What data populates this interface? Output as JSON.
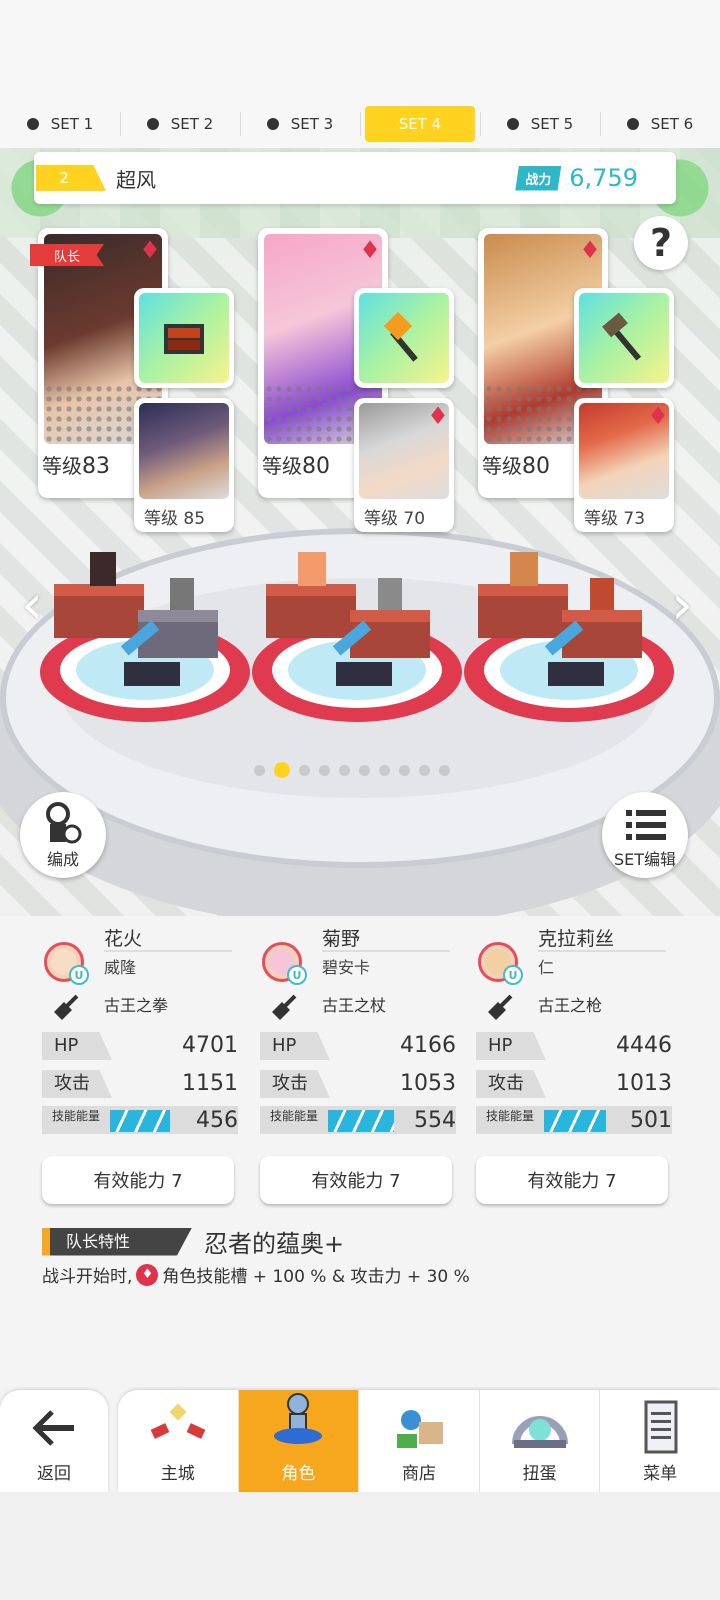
{
  "set_tabs": [
    {
      "label": "SET 1",
      "active": false
    },
    {
      "label": "SET 2",
      "active": false
    },
    {
      "label": "SET 3",
      "active": false
    },
    {
      "label": "SET 4",
      "active": true
    },
    {
      "label": "SET 5",
      "active": false
    },
    {
      "label": "SET 6",
      "active": false
    }
  ],
  "team": {
    "number": "2",
    "name": "超风",
    "power_label": "战力",
    "power_value": "6,759"
  },
  "help_label": "?",
  "leader_tag": "队长",
  "heroes": [
    {
      "level_label": "等级",
      "level": "83",
      "sub_level_label": "等级",
      "sub_level": "85"
    },
    {
      "level_label": "等级",
      "level": "80",
      "sub_level_label": "等级",
      "sub_level": "70"
    },
    {
      "level_label": "等级",
      "level": "80",
      "sub_level_label": "等级",
      "sub_level": "73"
    }
  ],
  "nav_arrows": {
    "left": "‹",
    "right": "›"
  },
  "page_dots": {
    "count": 10,
    "active_index": 1
  },
  "buttons": {
    "formation": "编成",
    "set_edit": "SET编辑"
  },
  "members": [
    {
      "name": "花火",
      "sub": "威隆",
      "weapon": "古王之拳",
      "hp_label": "HP",
      "hp": "4701",
      "atk_label": "攻击",
      "atk": "1151",
      "energy_label": "技能能量",
      "energy": "456",
      "energy_fraction": 0.62,
      "ability": "有效能力 7",
      "avatar_border": "#e94b5a"
    },
    {
      "name": "菊野",
      "sub": "碧安卡",
      "weapon": "古王之杖",
      "hp_label": "HP",
      "hp": "4166",
      "atk_label": "攻击",
      "atk": "1053",
      "energy_label": "技能能量",
      "energy": "554",
      "energy_fraction": 0.65,
      "ability": "有效能力 7",
      "avatar_border": "#e94b5a"
    },
    {
      "name": "克拉莉丝",
      "sub": "仁",
      "weapon": "古王之枪",
      "hp_label": "HP",
      "hp": "4446",
      "atk_label": "攻击",
      "atk": "1013",
      "energy_label": "技能能量",
      "energy": "501",
      "energy_fraction": 0.63,
      "ability": "有效能力 7",
      "avatar_border": "#e94b5a"
    }
  ],
  "leader_trait": {
    "tag": "队长特性",
    "name": "忍者的蕴奥+",
    "desc_prefix": "战斗开始时,",
    "desc_main": "角色技能槽 + 100 % & 攻击力 + 30 %"
  },
  "bottom_nav": {
    "back": "返回",
    "items": [
      {
        "label": "主城",
        "icon": "castle-icon",
        "active": false
      },
      {
        "label": "角色",
        "icon": "character-icon",
        "active": true
      },
      {
        "label": "商店",
        "icon": "shop-icon",
        "active": false
      },
      {
        "label": "扭蛋",
        "icon": "gacha-icon",
        "active": false
      },
      {
        "label": "菜单",
        "icon": "menu-icon",
        "active": false
      }
    ]
  },
  "colors": {
    "accent_yellow": "#ffd21f",
    "power_teal": "#2fb7c8",
    "nav_active": "#f7a71d",
    "rarity_red": "#e0334b",
    "energy_blue": "#28b6de"
  }
}
